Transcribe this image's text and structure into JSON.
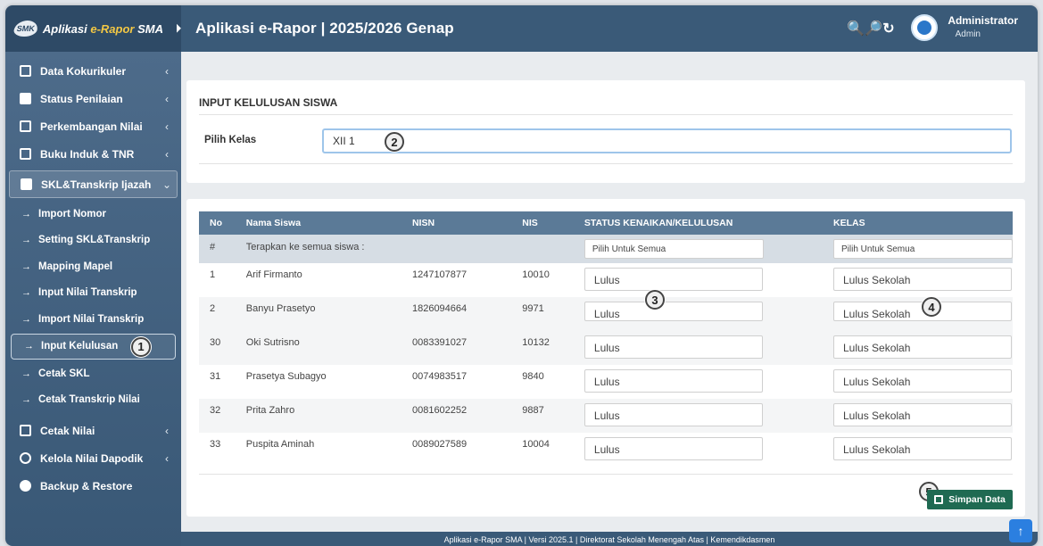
{
  "brand": {
    "badge": "SMK",
    "name_prefix": "Aplikasi ",
    "name_accent": "e-Rapor",
    "name_suffix": " SMA"
  },
  "header": {
    "title": "Aplikasi e-Rapor | 2025/2026 Genap",
    "user_name": "Administrator",
    "user_role": "Admin"
  },
  "sidebar": {
    "items": [
      {
        "label": "Data Kokurikuler",
        "icon": "clipboard-icon"
      },
      {
        "label": "Status Penilaian",
        "icon": "chart-line-icon"
      },
      {
        "label": "Perkembangan Nilai",
        "icon": "bar-chart-icon"
      },
      {
        "label": "Buku Induk & TNR",
        "icon": "book-icon"
      },
      {
        "label": "SKL&Transkrip Ijazah",
        "icon": "document-icon"
      }
    ],
    "subitems": [
      {
        "label": "Import Nomor"
      },
      {
        "label": "Setting SKL&Transkrip"
      },
      {
        "label": "Mapping Mapel"
      },
      {
        "label": "Input Nilai Transkrip"
      },
      {
        "label": "Import Nilai Transkrip"
      },
      {
        "label": "Input Kelulusan"
      },
      {
        "label": "Cetak SKL"
      },
      {
        "label": "Cetak Transkrip Nilai"
      }
    ],
    "bottom_items": [
      {
        "label": "Cetak Nilai",
        "icon": "printer-icon"
      },
      {
        "label": "Kelola Nilai Dapodik",
        "icon": "database-icon"
      },
      {
        "label": "Backup & Restore",
        "icon": "database-icon"
      }
    ]
  },
  "form": {
    "title": "INPUT KELULUSAN SISWA",
    "kelas_label": "Pilih Kelas",
    "kelas_value": "XII 1"
  },
  "table": {
    "headers": [
      "No",
      "Nama Siswa",
      "NISN",
      "NIS",
      "STATUS KENAIKAN/KELULUSAN",
      "KELAS"
    ],
    "apply_row": {
      "no": "#",
      "label": "Terapkan ke semua siswa :",
      "status": "Pilih Untuk Semua",
      "kelas": "Pilih Untuk Semua"
    },
    "rows": [
      {
        "no": "1",
        "nama": "Arif Firmanto",
        "nisn": "1247107877",
        "nis": "10010",
        "status": "Lulus",
        "kelas": "Lulus Sekolah"
      },
      {
        "no": "2",
        "nama": "Banyu Prasetyo",
        "nisn": "1826094664",
        "nis": "9971",
        "status": "Lulus",
        "kelas": "Lulus Sekolah"
      },
      {
        "no": "30",
        "nama": "Oki Sutrisno",
        "nisn": "0083391027",
        "nis": "10132",
        "status": "Lulus",
        "kelas": "Lulus Sekolah"
      },
      {
        "no": "31",
        "nama": "Prasetya Subagyo",
        "nisn": "0074983517",
        "nis": "9840",
        "status": "Lulus",
        "kelas": "Lulus Sekolah"
      },
      {
        "no": "32",
        "nama": "Prita Zahro",
        "nisn": "0081602252",
        "nis": "9887",
        "status": "Lulus",
        "kelas": "Lulus Sekolah"
      },
      {
        "no": "33",
        "nama": "Puspita Aminah",
        "nisn": "0089027589",
        "nis": "10004",
        "status": "Lulus",
        "kelas": "Lulus Sekolah"
      }
    ]
  },
  "save_button": "Simpan Data",
  "footer": "Aplikasi e-Rapor SMA | Versi 2025.1 | Direktorat Sekolah Menengah Atas | Kemendikdasmen",
  "callouts": [
    "1",
    "2",
    "3",
    "4",
    "5"
  ]
}
